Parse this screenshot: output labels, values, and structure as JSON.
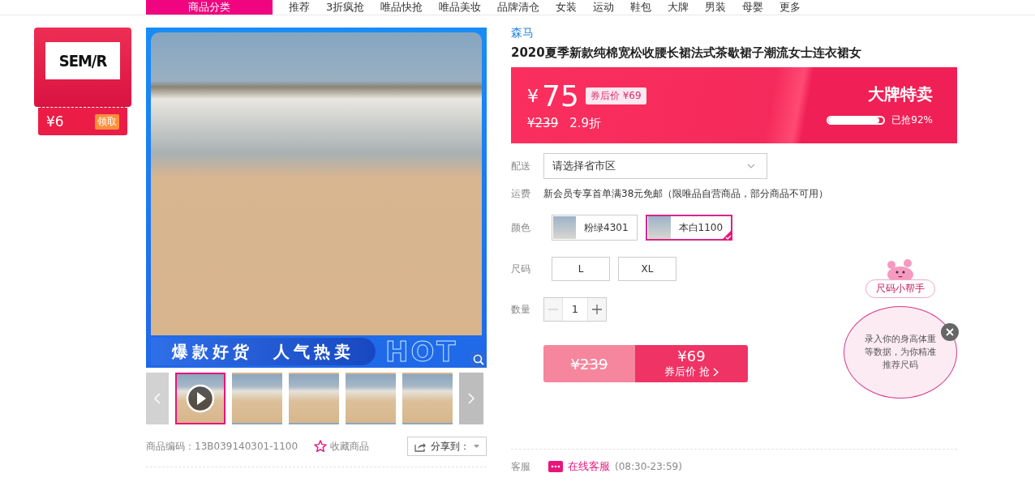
{
  "nav": {
    "items": [
      {
        "label": "商品分类",
        "selected": true
      },
      {
        "label": "推荐",
        "selected": false
      },
      {
        "label": "3折疯抢",
        "selected": false
      },
      {
        "label": "唯品快抢",
        "selected": false
      },
      {
        "label": "唯品美妆",
        "selected": false
      },
      {
        "label": "品牌清仓",
        "selected": false
      },
      {
        "label": "女装",
        "selected": false
      },
      {
        "label": "运动",
        "selected": false
      },
      {
        "label": "鞋包",
        "selected": false
      },
      {
        "label": "大牌",
        "selected": false
      },
      {
        "label": "男装",
        "selected": false
      },
      {
        "label": "母婴",
        "selected": false
      },
      {
        "label": "更多",
        "selected": false
      }
    ]
  },
  "coupon": {
    "brand": "SEM/R",
    "amount": "¥6",
    "action": "领取"
  },
  "gallery": {
    "banner": "爆款好货　人气热卖",
    "badge": "HOT",
    "thumbnails": [
      {
        "kind": "video",
        "selected": true
      },
      {
        "kind": "image",
        "selected": false
      },
      {
        "kind": "image",
        "selected": false
      },
      {
        "kind": "image",
        "selected": false
      },
      {
        "kind": "image",
        "selected": false
      }
    ]
  },
  "product_code": "商品编码：13B039140301-1100",
  "favorite": "收藏商品",
  "share": "分享到：",
  "brand": "森马",
  "title": "2020夏季新款纯棉宽松收腰长裙法式茶歇裙子潮流女士连衣裙女",
  "price": {
    "currency": "¥",
    "amount": "75",
    "coupon_price": "券后价 ¥69",
    "original": "¥239",
    "discount": "2.9折",
    "promo": "大牌特卖",
    "sold": {
      "level": 0.92,
      "text": "已抢92%"
    }
  },
  "delivery": {
    "label": "配送",
    "value": "请选择省市区"
  },
  "shipping": {
    "label": "运费",
    "text": "新会员专享首单满38元免邮（限唯品自营商品，部分商品不可用）"
  },
  "colors": {
    "label": "颜色",
    "options": [
      {
        "label": "粉绿4301",
        "selected": false
      },
      {
        "label": "本白1100",
        "selected": true
      }
    ]
  },
  "sizes": {
    "label": "尺码",
    "options": [
      {
        "label": "L",
        "selected": false
      },
      {
        "label": "XL",
        "selected": false
      }
    ]
  },
  "quantity": {
    "label": "数量",
    "value": "1"
  },
  "buy": {
    "original": "¥239",
    "price": "¥69",
    "action": "券后价 抢"
  },
  "helper": {
    "title": "尺码小帮手",
    "text": "录入你的身高体重等数据，为你精准推荐尺码"
  },
  "service": {
    "label": "客服",
    "link": "在线客服",
    "hours": "(08:30-23:59)"
  }
}
